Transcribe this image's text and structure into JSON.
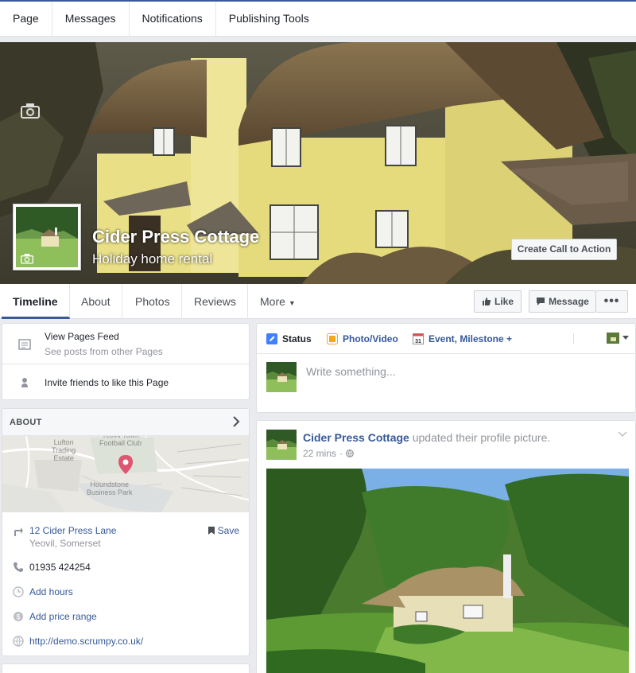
{
  "topnav": {
    "items": [
      {
        "label": "Page"
      },
      {
        "label": "Messages"
      },
      {
        "label": "Notifications"
      },
      {
        "label": "Publishing Tools"
      }
    ]
  },
  "cover": {
    "page_name": "Cider Press Cottage",
    "category": "Holiday home rental",
    "cta_label": "Create Call to Action"
  },
  "tabs": {
    "items": [
      {
        "label": "Timeline"
      },
      {
        "label": "About"
      },
      {
        "label": "Photos"
      },
      {
        "label": "Reviews"
      },
      {
        "label": "More"
      }
    ],
    "active": "Timeline",
    "like_label": "Like",
    "message_label": "Message",
    "more_label": "•••"
  },
  "sidebar": {
    "feed": {
      "title": "View Pages Feed",
      "subtitle": "See posts from other Pages",
      "invite": "Invite friends to like this Page"
    },
    "about": {
      "heading": "ABOUT",
      "map_labels": {
        "top": "Yeovil Town\nFootball Club",
        "left": "Lufton\nTrading\nEstate",
        "bottom": "Houndstone\nBusiness Park"
      },
      "address_line1": "12 Cider Press Lane",
      "address_line2": "Yeovil, Somerset",
      "save_label": "Save",
      "phone": "01935 424254",
      "hours": "Add hours",
      "price": "Add price range",
      "website": "http://demo.scrumpy.co.uk/"
    }
  },
  "composer": {
    "tabs": [
      {
        "label": "Status"
      },
      {
        "label": "Photo/Video"
      },
      {
        "label": "Event, Milestone +"
      }
    ],
    "event_icon_day": "31",
    "placeholder": "Write something..."
  },
  "post": {
    "author": "Cider Press Cottage",
    "action": "updated their profile picture.",
    "time": "22 mins",
    "separator": "·"
  },
  "colors": {
    "brand": "#3b5998",
    "link": "#365899",
    "cover_wall": "#e8dc7a",
    "thatch": "#6e5a3c"
  },
  "icons": [
    "camera-icon",
    "thumbs-up-icon",
    "message-icon",
    "news-feed-icon",
    "invite-icon",
    "chevron-right-icon",
    "map-pin-icon",
    "directions-icon",
    "bookmark-icon",
    "phone-icon",
    "clock-icon",
    "price-icon",
    "globe-icon",
    "pencil-icon",
    "photo-icon",
    "calendar-icon",
    "chevron-down-icon"
  ]
}
